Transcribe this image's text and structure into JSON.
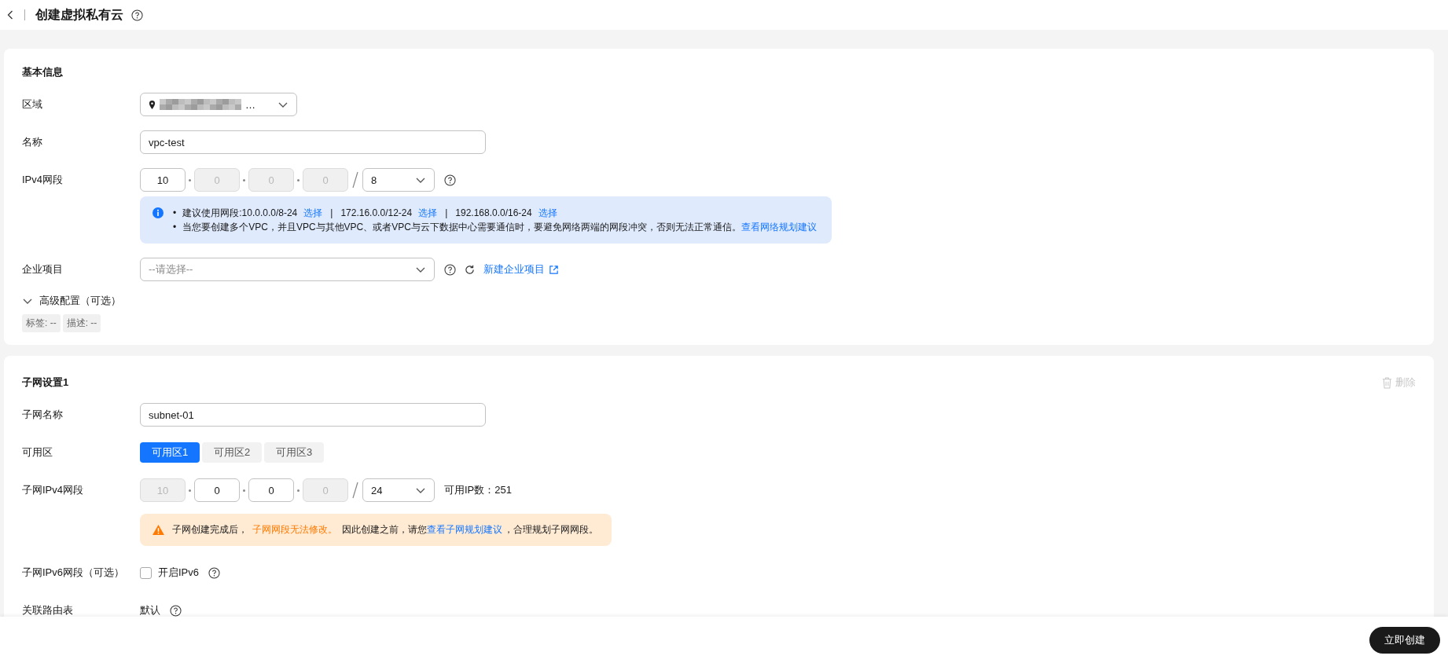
{
  "header": {
    "title": "创建虚拟私有云"
  },
  "basic": {
    "heading": "基本信息",
    "region": {
      "label": "区域",
      "value_blurred": true,
      "value": "…"
    },
    "name": {
      "label": "名称",
      "value": "vpc-test"
    },
    "ipv4": {
      "label": "IPv4网段",
      "octets": [
        {
          "value": "10",
          "disabled": false
        },
        {
          "value": "0",
          "disabled": true
        },
        {
          "value": "0",
          "disabled": true
        },
        {
          "value": "0",
          "disabled": true
        }
      ],
      "mask": "8"
    },
    "suggestion": {
      "bullet": "•",
      "prefix": "建议使用网段:",
      "ranges": [
        {
          "range": "10.0.0.0/8-24",
          "action": "选择"
        },
        {
          "separator": "|",
          "range": "172.16.0.0/12-24",
          "action": "选择"
        },
        {
          "separator": "|",
          "range": "192.168.0.0/16-24",
          "action": "选择"
        }
      ]
    },
    "notice": {
      "bullet": "•",
      "text": "当您要创建多个VPC，并且VPC与其他VPC、或者VPC与云下数据中心需要通信时，要避免网络两端的网段冲突，否则无法正常通信。",
      "link": "查看网络规划建议"
    },
    "enterprise": {
      "label": "企业项目",
      "placeholder": "--请选择--",
      "link": "新建企业项目"
    },
    "advanced": {
      "label": "高级配置（可选）",
      "expanded": false,
      "summary": [
        "标签: --",
        "描述: --"
      ]
    }
  },
  "subnet": {
    "heading": "子网设置1",
    "delete": {
      "label": "删除",
      "disabled": true
    },
    "name": {
      "label": "子网名称",
      "value": "subnet-01"
    },
    "zones": {
      "label": "可用区",
      "options": [
        {
          "label": "可用区1",
          "selected": true
        },
        {
          "label": "可用区2",
          "selected": false
        },
        {
          "label": "可用区3",
          "selected": false
        }
      ]
    },
    "ipv4": {
      "label": "子网IPv4网段",
      "octets": [
        {
          "value": "10",
          "disabled": true
        },
        {
          "value": "0",
          "disabled": false
        },
        {
          "value": "0",
          "disabled": false
        },
        {
          "value": "0",
          "disabled": true
        }
      ],
      "mask": "24",
      "available": "可用IP数：251"
    },
    "warning": {
      "segments": [
        {
          "kind": "text",
          "text": "子网创建完成后，"
        },
        {
          "kind": "highlight",
          "text": "子网网段无法修改。"
        },
        {
          "kind": "text",
          "text": "因此创建之前，请您"
        },
        {
          "kind": "link",
          "text": "查看子网规划建议"
        },
        {
          "kind": "text",
          "text": "，合理规划子网网段。"
        }
      ]
    },
    "ipv6": {
      "label": "子网IPv6网段（可选）",
      "checkbox": "开启IPv6",
      "checked": false
    },
    "route": {
      "label": "关联路由表",
      "value": "默认"
    }
  },
  "footer": {
    "button": "立即创建"
  }
}
